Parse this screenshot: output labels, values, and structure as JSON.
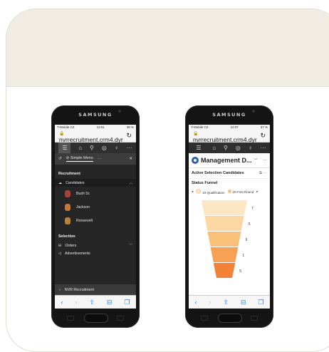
{
  "phones": {
    "left": {
      "brand": "SAMSUNG",
      "status": {
        "carrier": "T-Mobile CZ",
        "time": "11:01",
        "battery": "38 %"
      },
      "url": "nvrrecruitment.crm4.dyr",
      "menu": {
        "tab_label": "Simple Menu",
        "section_recruitment": "Recruitment",
        "candidates": "Candidates",
        "people": [
          "Bush Sr.",
          "Jackson",
          "Roosevelt"
        ],
        "section_selection": "Selection",
        "orders": "Orders",
        "advertisements": "Advertisements",
        "bottom_app": "NVR Recruitment"
      }
    },
    "right": {
      "brand": "SAMSUNG",
      "status": {
        "carrier": "T-Mobile CZ",
        "time": "11:07",
        "battery": "37 %"
      },
      "url": "nvrrecruitment.crm4.dyr",
      "app_title": "Management D...",
      "section_title": "Active Selection Candidates",
      "chart_title": "Status Funnel",
      "legend": [
        "10-Qualification",
        "20-First Round"
      ]
    }
  },
  "chart_data": {
    "type": "funnel",
    "title": "Status Funnel",
    "series": [
      {
        "name": "Candidates",
        "values": [
          7,
          5,
          6,
          1,
          5
        ]
      }
    ],
    "legend": [
      "10-Qualification",
      "20-First Round"
    ],
    "colors": [
      "#fde6c4",
      "#fbd7a3",
      "#f9c07a",
      "#f7a155",
      "#f48138"
    ]
  },
  "colors": {
    "accent_blue": "#2f7de1",
    "nav_dark": "#2f2f2f",
    "menu_dark": "#262626",
    "card_head": "#f1ede4"
  }
}
